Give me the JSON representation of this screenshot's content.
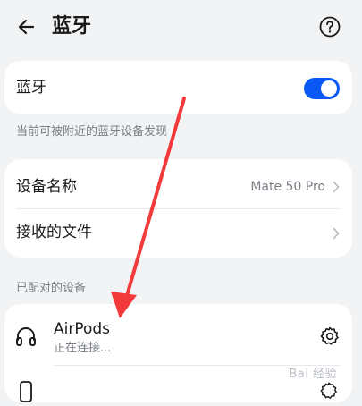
{
  "header": {
    "title": "蓝牙",
    "back_icon": "arrow-left-icon",
    "help_icon": "help-circle-icon"
  },
  "bluetooth_toggle": {
    "label": "蓝牙",
    "enabled": true,
    "accent_color": "#0a59f7"
  },
  "visibility_note": "当前可被附近的蓝牙设备发现",
  "device_settings": {
    "rows": [
      {
        "label": "设备名称",
        "value": "Mate 50 Pro"
      },
      {
        "label": "接收的文件",
        "value": ""
      }
    ]
  },
  "paired_section": {
    "caption": "已配对的设备",
    "devices": [
      {
        "name": "AirPods",
        "status": "正在连接...",
        "icon": "headphones-icon",
        "action_icon": "gear-icon"
      }
    ]
  },
  "annotation": {
    "arrow_color": "#f23a3a"
  },
  "watermark": {
    "text": "Bai 经验"
  }
}
